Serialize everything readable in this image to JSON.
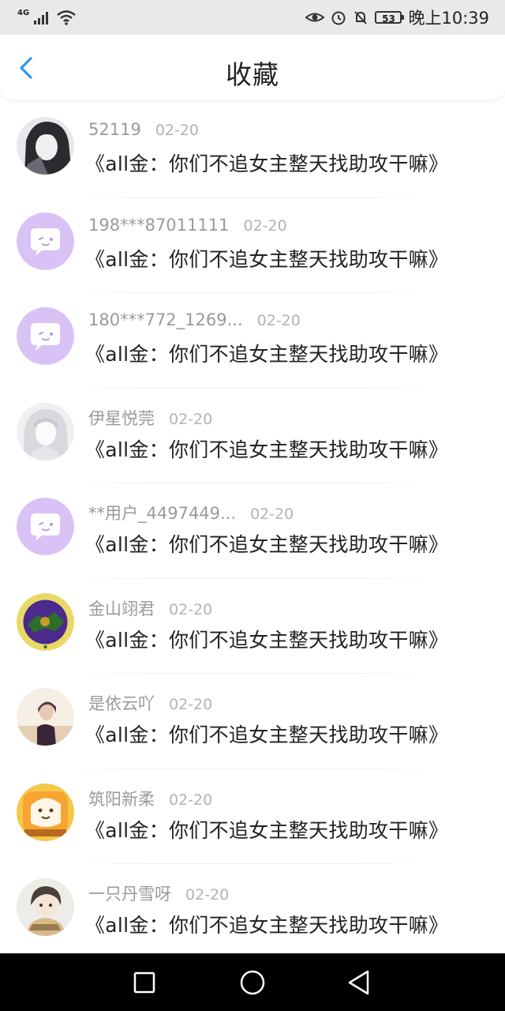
{
  "status_bar": {
    "network": "4G",
    "battery": "53",
    "time": "晚上10:39"
  },
  "header": {
    "title": "收藏"
  },
  "items": [
    {
      "name": "52119",
      "date": "02-20",
      "message": "《all金：你们不追女主整天找助攻干嘛》",
      "avatar": "dark-hair-anime-avatar"
    },
    {
      "name": "198***87011111",
      "date": "02-20",
      "message": "《all金：你们不追女主整天找助攻干嘛》",
      "avatar": "default-chat-avatar"
    },
    {
      "name": "180***772_1269...",
      "date": "02-20",
      "message": "《all金：你们不追女主整天找助攻干嘛》",
      "avatar": "default-chat-avatar"
    },
    {
      "name": "伊星悦莞",
      "date": "02-20",
      "message": "《all金：你们不追女主整天找助攻干嘛》",
      "avatar": "white-hair-anime-avatar"
    },
    {
      "name": "**用户_4497449...",
      "date": "02-20",
      "message": "《all金：你们不追女主整天找助攻干嘛》",
      "avatar": "default-chat-avatar"
    },
    {
      "name": "金山翊君",
      "date": "02-20",
      "message": "《all金：你们不追女主整天找助攻干嘛》",
      "avatar": "purple-emblem-avatar"
    },
    {
      "name": "是依云吖",
      "date": "02-20",
      "message": "《all金：你们不追女主整天找助攻干嘛》",
      "avatar": "person-photo-avatar"
    },
    {
      "name": "筑阳新柔",
      "date": "02-20",
      "message": "《all金：你们不追女主整天找助攻干嘛》",
      "avatar": "cartoon-bread-avatar"
    },
    {
      "name": "一只丹雪呀",
      "date": "02-20",
      "message": "《all金：你们不追女主整天找助攻干嘛》",
      "avatar": "anime-boy-avatar"
    }
  ],
  "nav_bar": {
    "buttons": [
      "recent-apps-icon",
      "home-icon",
      "back-icon"
    ]
  },
  "colors": {
    "accent": "#2f95f2",
    "default_avatar": "#d9c2f5",
    "name_text": "#9a9a9a",
    "date_text": "#b3b3b3"
  }
}
